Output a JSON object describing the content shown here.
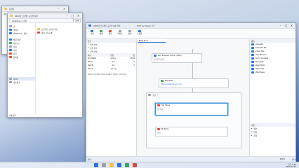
{
  "explorer_back": {
    "tab_title": "사진들",
    "toolbar_label": "새로 만들기"
  },
  "explorer_front": {
    "tab_title": "2024년 프로젝트 공모전 사진",
    "breadcrumb": "OneDrive > 사진",
    "search_placeholder": "검색",
    "sidebar_items": [
      "홈",
      "갤러리",
      "OneDrive - 개인",
      "바탕 화면",
      "다운로드",
      "문서",
      "사진",
      "음악",
      "동영상",
      "내 PC",
      "네트워크"
    ],
    "files": [
      "프로젝트 공모전 자료",
      "회의 기록.pdf"
    ],
    "status": "2개 항목"
  },
  "editor": {
    "tab_title": "2024년 프로젝트 공모전 제출 목록",
    "window_title": "BPSE Ver Maker 편집",
    "toolbar": [
      "저장",
      "실행",
      "중지",
      "디버그",
      "설정",
      "도움말"
    ],
    "left_panel": {
      "header": "변수",
      "sections": [
        "입력 변수",
        "출력 변수",
        "전역 변수"
      ],
      "columns": [
        "이름",
        "유형",
        "값"
      ],
      "rows": [
        [
          "ProdDate",
          "string",
          "2024"
        ],
        [
          "ItemA",
          "int",
          "0"
        ],
        [
          "ItemB",
          "int",
          "0"
        ],
        [
          "ItemC",
          "string",
          "-"
        ]
      ],
      "note": "GetCompetitionResults에서 결과를 가져옵니다"
    },
    "flow_tab": "Main Flow",
    "flow_cards": [
      {
        "title": "Run Browser action (Web)",
        "sub": "브라우저 열기"
      },
      {
        "title": "Navigate",
        "sub": "https://www.naver.com/"
      },
      {
        "title": "조건",
        "sub": "If"
      },
      {
        "title": "Set Value",
        "sub": "값 설정"
      },
      {
        "title": "Multiple",
        "sub": "반복"
      }
    ],
    "right_panel": {
      "header": "활동",
      "items": [
        "Activate",
        "Activate Tab",
        "Close Tab",
        "Get Tab Info",
        "Go to Address",
        "Navigate",
        "Read Item",
        "Read URL",
        "Wait Page"
      ],
      "bottom_header": "속성",
      "bottom_items": [
        "일반",
        "입력",
        "출력"
      ]
    },
    "statusbar": [
      "준비",
      "100%",
      "줄 1"
    ]
  },
  "taskbar": {
    "clock": "오후 3:24",
    "date": "2024-05-20"
  }
}
